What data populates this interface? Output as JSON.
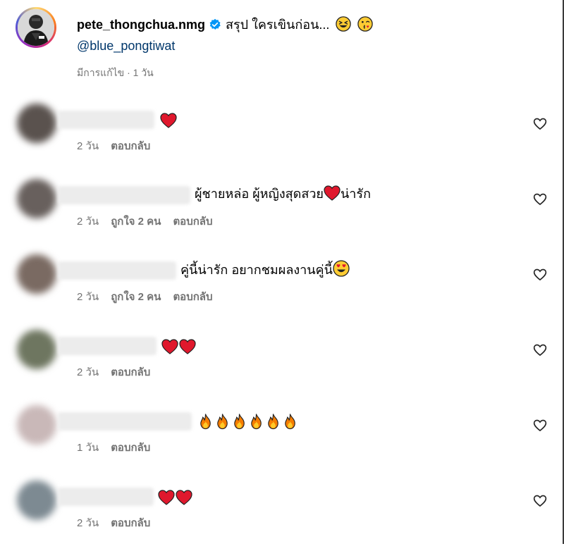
{
  "post": {
    "username": "pete_thongchua.nmg",
    "caption": "สรุป ใครเขินก่อน...",
    "caption_emojis": [
      "grinning-squinting-face",
      "face-blowing-kiss"
    ],
    "mention": "@blue_pongtiwat",
    "meta": "มีการแก้ไข · 1 วัน"
  },
  "comments": [
    {
      "text": "",
      "emojis": [
        "red-heart"
      ],
      "time": "2 วัน",
      "likes": "",
      "reply": "ตอบกลับ"
    },
    {
      "text": "ผู้ชายหล่อ ผู้หญิงสุดสวย",
      "text_after": "น่ารัก",
      "emojis": [
        "red-heart"
      ],
      "time": "2 วัน",
      "likes": "ถูกใจ 2 คน",
      "reply": "ตอบกลับ"
    },
    {
      "text": "คู่นี้น่ารัก อยากชมผลงานคู่นี้",
      "emojis": [
        "heart-eyes-face"
      ],
      "time": "2 วัน",
      "likes": "ถูกใจ 2 คน",
      "reply": "ตอบกลับ"
    },
    {
      "text": "",
      "emojis": [
        "red-heart",
        "red-heart"
      ],
      "time": "2 วัน",
      "likes": "",
      "reply": "ตอบกลับ"
    },
    {
      "text": "",
      "emojis": [
        "fire",
        "fire",
        "fire",
        "fire",
        "fire",
        "fire"
      ],
      "time": "1 วัน",
      "likes": "",
      "reply": "ตอบกลับ"
    },
    {
      "text": "",
      "emojis": [
        "red-heart",
        "red-heart"
      ],
      "time": "2 วัน",
      "likes": "",
      "reply": "ตอบกลับ"
    }
  ],
  "colors": {
    "link": "#00376b",
    "verified": "#0095f6",
    "meta_text": "#737373",
    "heart": "#e0182d"
  }
}
